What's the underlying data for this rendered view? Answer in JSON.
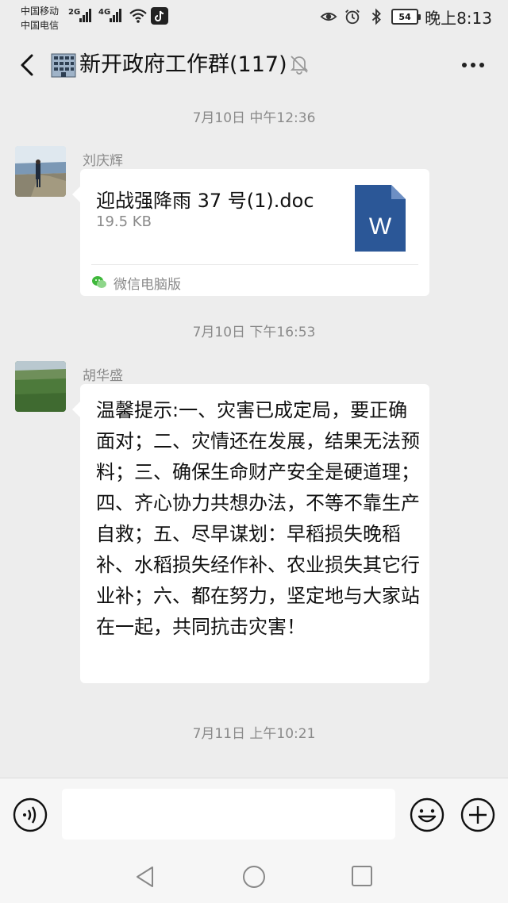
{
  "status_bar": {
    "carrier_1": "中国移动",
    "carrier_2": "中国电信",
    "network_1": "2G",
    "network_2": "4G",
    "battery": "54",
    "time": "晚上8:13",
    "icons": [
      "signal-icon",
      "wifi-icon",
      "tiktok-icon",
      "eye-icon",
      "alarm-icon",
      "bluetooth-icon",
      "battery-icon"
    ]
  },
  "header": {
    "title": "新开政府工作群(117)",
    "back_icon": "chevron-left-icon",
    "group_icon": "building-icon",
    "mute_icon": "bell-muted-icon",
    "more_icon": "more-icon"
  },
  "messages": [
    {
      "timestamp": "7月10日 中午12:36",
      "sender": "刘庆辉",
      "type": "file",
      "file_name": "迎战强降雨 37 号(1).doc",
      "file_size": "19.5 KB",
      "file_icon_letter": "W",
      "source": "微信电脑版"
    },
    {
      "timestamp": "7月10日 下午16:53",
      "sender": "胡华盛",
      "type": "text",
      "text": "温馨提示:一、灾害已成定局，要正确面对；二、灾情还在发展，结果无法预料；三、确保生命财产安全是硬道理；四、齐心协力共想办法，不等不靠生产自救；五、尽早谋划：早稻损失晚稻补、水稻损失经作补、农业损失其它行业补；六、都在努力，坚定地与大家站在一起，共同抗击灾害！"
    }
  ],
  "last_timestamp": "7月11日 上午10:21",
  "input_bar": {
    "value": "",
    "icons": [
      "voice-icon",
      "emoji-icon",
      "plus-icon"
    ]
  },
  "system_nav": {
    "icons": [
      "nav-back-icon",
      "nav-home-icon",
      "nav-recent-icon"
    ]
  },
  "colors": {
    "background": "#ededed",
    "bubble": "#ffffff",
    "word_icon": "#2b5797",
    "secondary_text": "#8a8a8a"
  }
}
